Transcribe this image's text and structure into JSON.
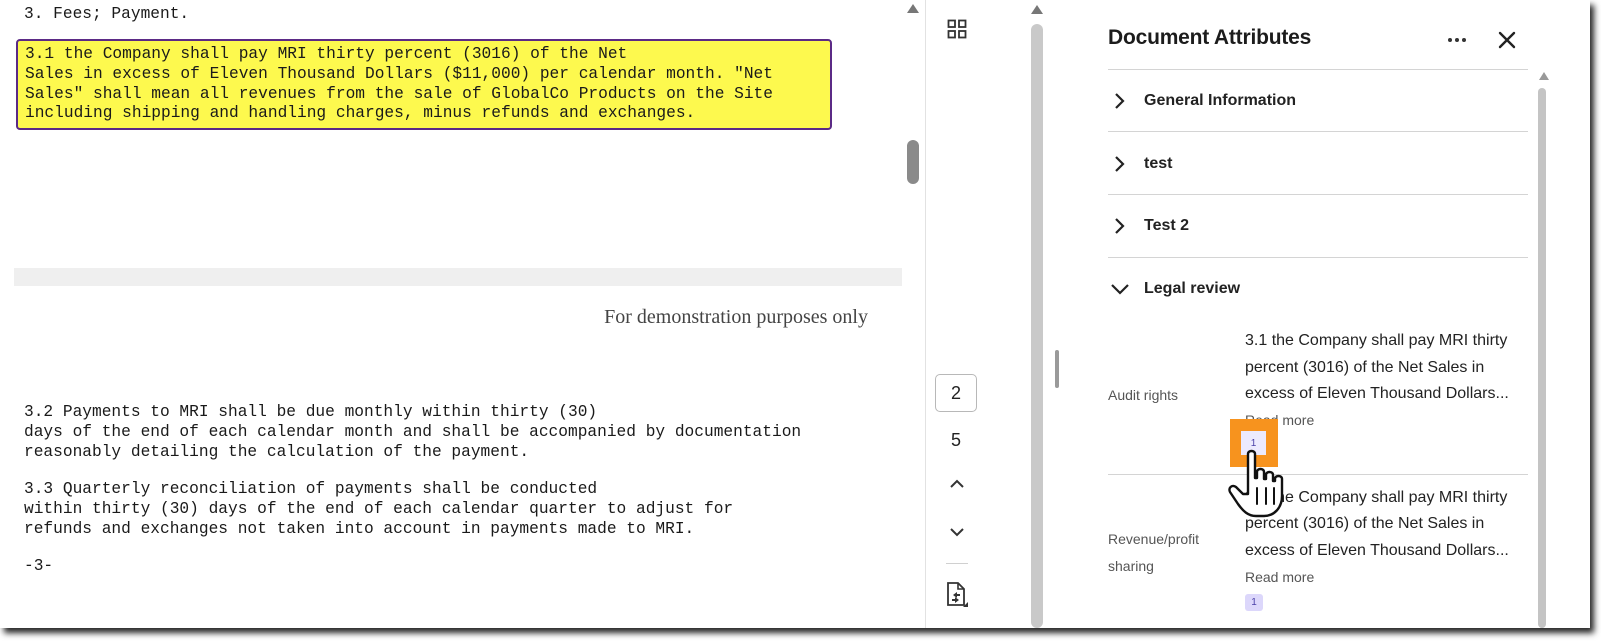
{
  "document": {
    "heading": "3. Fees; Payment.",
    "highlighted_lines": [
      "3.1 the Company shall pay MRI thirty percent (3016) of the Net",
      "Sales in excess of Eleven Thousand Dollars ($11,000) per calendar month. \"Net",
      "Sales\" shall mean all revenues from the sale of GlobalCo Products on the Site",
      "including shipping and handling charges, minus refunds and exchanges."
    ],
    "watermark": "For demonstration purposes only",
    "para_3_2": [
      "3.2 Payments to MRI shall be due monthly within thirty (30)",
      "days of the end of each calendar month and shall be accompanied by documentation",
      "reasonably detailing the calculation of the payment."
    ],
    "para_3_3": [
      "3.3 Quarterly reconciliation of payments shall be conducted",
      "within thirty (30) days of the end of each calendar quarter to adjust for",
      "refunds and exchanges not taken into account in payments made to MRI."
    ],
    "page_footer": "-3-"
  },
  "page_nav": {
    "current_page": "2",
    "total_pages": "5",
    "icons": [
      "thumbnails-grid-icon",
      "chevron-up-icon",
      "chevron-down-icon",
      "page-tool-icon"
    ]
  },
  "panel": {
    "title": "Document Attributes",
    "sections": [
      {
        "label": "General Information",
        "expanded": false
      },
      {
        "label": "test",
        "expanded": false
      },
      {
        "label": "Test 2",
        "expanded": false
      },
      {
        "label": "Legal review",
        "expanded": true
      }
    ],
    "attributes": [
      {
        "label_lines": [
          "Audit rights"
        ],
        "value_lines": [
          "3.1 the Company shall pay MRI thirty",
          "percent (3016) of the Net Sales in",
          "excess of Eleven Thousand Dollars..."
        ],
        "read_more": "Read more",
        "badge": "1"
      },
      {
        "label_lines": [
          "Revenue/profit",
          "sharing"
        ],
        "value_lines": [
          "3.1 the Company shall pay MRI thirty",
          "percent (3016) of the Net Sales in",
          "excess of Eleven Thousand Dollars..."
        ],
        "read_more": "Read more",
        "badge": "1"
      }
    ]
  },
  "colors": {
    "highlight_fill": "#fdf94e",
    "highlight_border": "#5b2a86",
    "focus_ring": "#f7931e",
    "badge_bg": "#dcd7fb"
  }
}
